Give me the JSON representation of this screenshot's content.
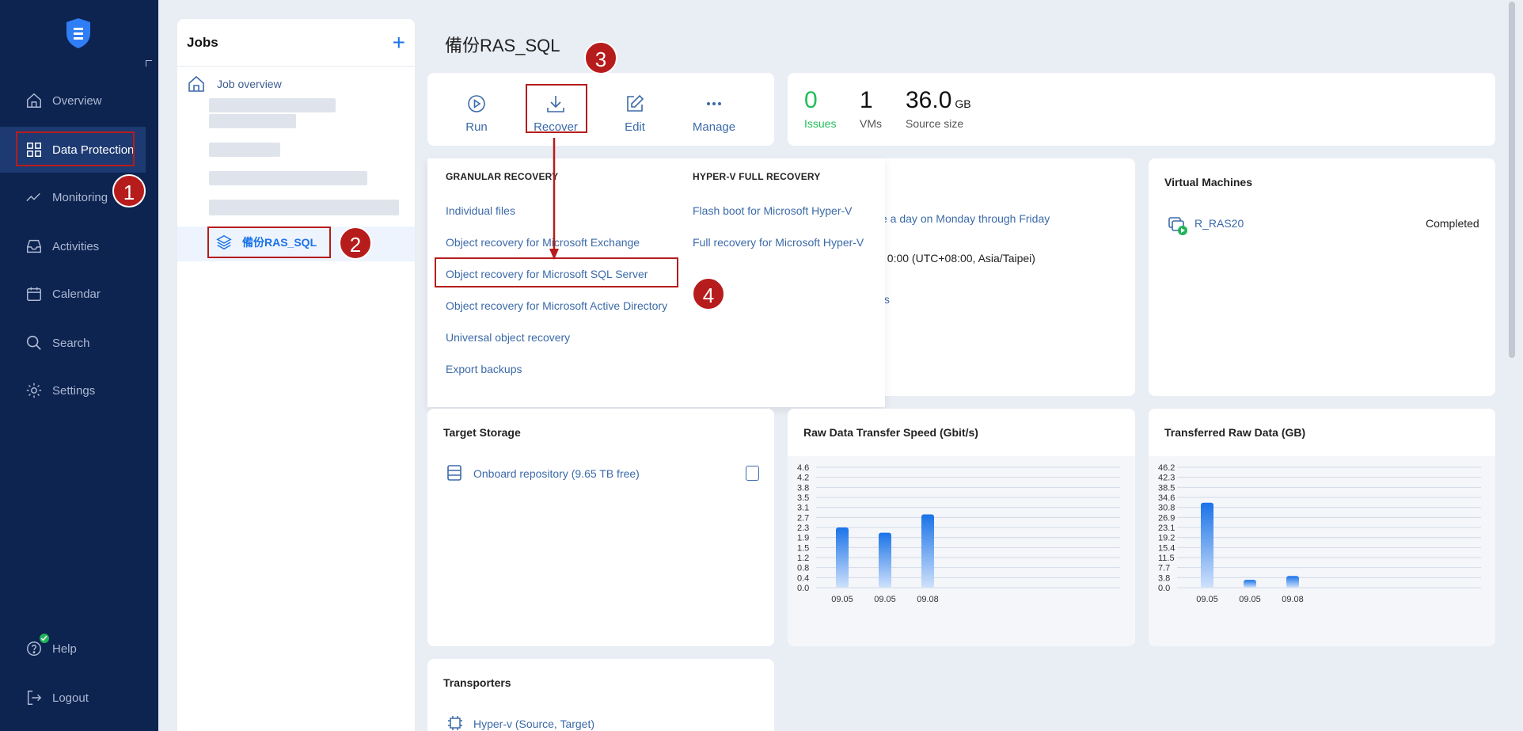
{
  "nav": {
    "items": [
      {
        "label": "Overview",
        "icon": "home-icon"
      },
      {
        "label": "Data Protection",
        "icon": "grid-icon"
      },
      {
        "label": "Monitoring",
        "icon": "chart-line-icon"
      },
      {
        "label": "Activities",
        "icon": "inbox-icon"
      },
      {
        "label": "Calendar",
        "icon": "calendar-icon"
      },
      {
        "label": "Search",
        "icon": "search-icon"
      },
      {
        "label": "Settings",
        "icon": "gear-icon"
      }
    ],
    "help": "Help",
    "logout": "Logout"
  },
  "jobs": {
    "title": "Jobs",
    "add": "+",
    "overview": "Job overview",
    "selected_job": "備份RAS_SQL"
  },
  "page": {
    "title": "備份RAS_SQL"
  },
  "actions": {
    "run": "Run",
    "recover": "Recover",
    "edit": "Edit",
    "manage": "Manage"
  },
  "stats": {
    "issues_value": "0",
    "issues_label": "Issues",
    "vms_value": "1",
    "vms_label": "VMs",
    "size_value": "36.0",
    "size_unit": "GB",
    "size_label": "Source size"
  },
  "dropdown": {
    "granular_title": "GRANULAR RECOVERY",
    "granular_items": [
      "Individual files",
      "Object recovery for Microsoft Exchange",
      "Object recovery for Microsoft SQL Server",
      "Object recovery for Microsoft Active Directory",
      "Universal object recovery",
      "Export backups"
    ],
    "hyperv_title": "HYPER-V FULL RECOVERY",
    "hyperv_items": [
      "Flash boot for Microsoft Hyper-V",
      "Full recovery for Microsoft Hyper-V"
    ]
  },
  "schedule": {
    "line1": "e a day on Monday through Friday",
    "line2": ": 0:00 (UTC+08:00, Asia/Taipei)",
    "line3": "ıs"
  },
  "vms": {
    "title": "Virtual Machines",
    "name": "R_RAS20",
    "status": "Completed"
  },
  "target_storage": {
    "title": "Target Storage",
    "repo": "Onboard repository (9.65 TB free)"
  },
  "transporters": {
    "title": "Transporters",
    "item": "Hyper-v (Source, Target)"
  },
  "badges": [
    "1",
    "2",
    "3",
    "4"
  ],
  "chart_data": [
    {
      "type": "bar",
      "title": "Raw Data Transfer Speed (Gbit/s)",
      "categories": [
        "09.05",
        "09.05",
        "09.08"
      ],
      "values": [
        2.3,
        2.1,
        2.8
      ],
      "yticks": [
        "4.6",
        "4.2",
        "3.8",
        "3.5",
        "3.1",
        "2.7",
        "2.3",
        "1.9",
        "1.5",
        "1.2",
        "0.8",
        "0.4",
        "0.0"
      ],
      "ylim": [
        0,
        4.6
      ]
    },
    {
      "type": "bar",
      "title": "Transferred Raw Data (GB)",
      "categories": [
        "09.05",
        "09.05",
        "09.08"
      ],
      "values": [
        32.6,
        3.0,
        4.5
      ],
      "yticks": [
        "46.2",
        "42.3",
        "38.5",
        "34.6",
        "30.8",
        "26.9",
        "23.1",
        "19.2",
        "15.4",
        "11.5",
        "7.7",
        "3.8",
        "0.0"
      ],
      "ylim": [
        0,
        46.2
      ]
    }
  ],
  "colors": {
    "accent": "#1a73e8",
    "nav_bg": "#0d2350",
    "annotation": "#b71c1c",
    "issues": "#1fbf5a"
  }
}
